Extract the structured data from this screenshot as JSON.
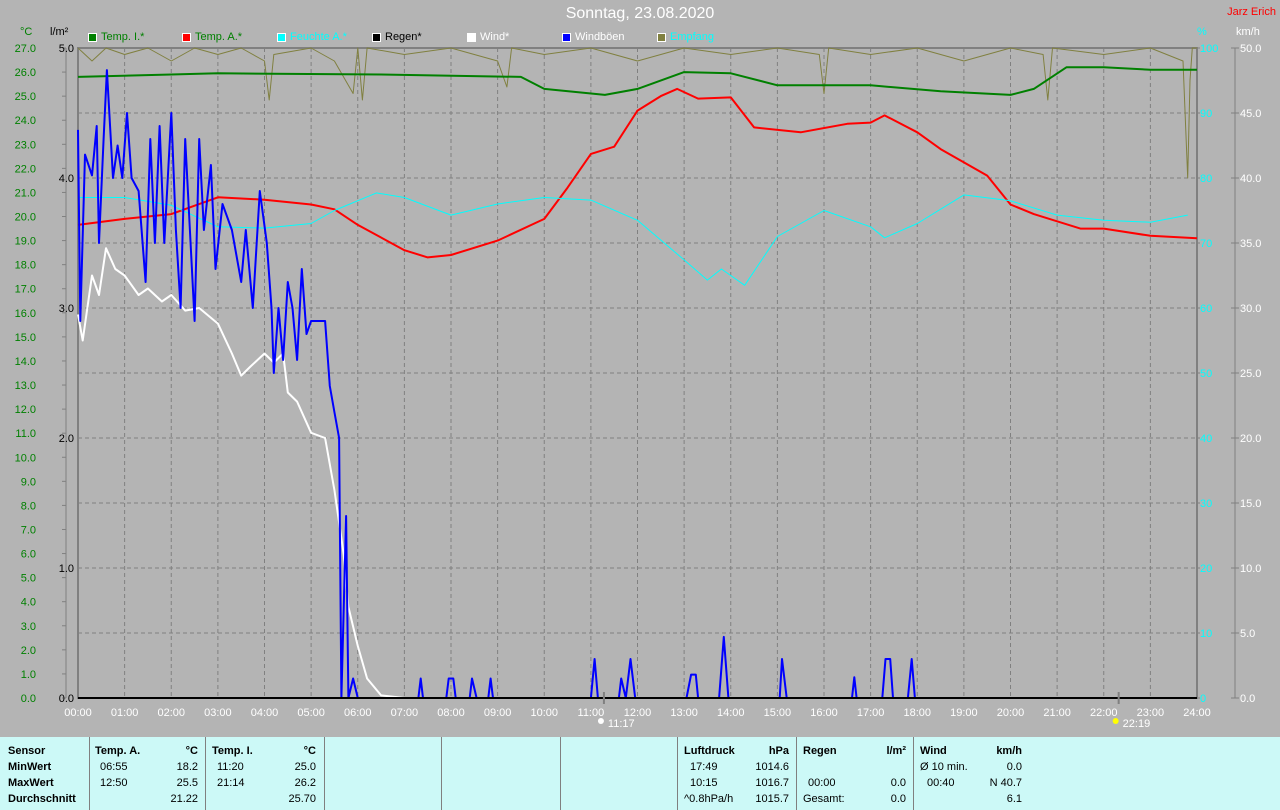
{
  "header": {
    "title": "Sonntag, 23.08.2020",
    "author": "Jarz Erich",
    "unit_temp": "°C",
    "unit_rain": "l/m²",
    "unit_hum": "%",
    "unit_wind": "km/h"
  },
  "legend": [
    {
      "label": "Temp. I.*",
      "color": "#008000",
      "text_color": "#008000"
    },
    {
      "label": "Temp. A.*",
      "color": "#ff0000",
      "text_color": "#008000"
    },
    {
      "label": "Feuchte A.*",
      "color": "#00ffff",
      "text_color": "#00ffff"
    },
    {
      "label": "Regen*",
      "color": "#000000",
      "text_color": "#000000"
    },
    {
      "label": "Wind*",
      "color": "#ffffff",
      "text_color": "#ffffff"
    },
    {
      "label": "Windböen",
      "color": "#0000ff",
      "text_color": "#ffffff"
    },
    {
      "label": "Empfang",
      "color": "#808040",
      "text_color": "#00ffff"
    }
  ],
  "chart_data": {
    "type": "line",
    "title": "Sonntag, 23.08.2020",
    "xlim": [
      0,
      24
    ],
    "x_ticks": [
      "00:00",
      "01:00",
      "02:00",
      "03:00",
      "04:00",
      "05:00",
      "06:00",
      "07:00",
      "08:00",
      "09:00",
      "10:00",
      "11:00",
      "12:00",
      "13:00",
      "14:00",
      "15:00",
      "16:00",
      "17:00",
      "18:00",
      "19:00",
      "20:00",
      "21:00",
      "22:00",
      "23:00",
      "24:00"
    ],
    "axes": {
      "temp": {
        "label": "°C",
        "ylim": [
          0,
          27
        ],
        "ticks": [
          "0.0",
          "1.0",
          "2.0",
          "3.0",
          "4.0",
          "5.0",
          "6.0",
          "7.0",
          "8.0",
          "9.0",
          "10.0",
          "11.0",
          "12.0",
          "13.0",
          "14.0",
          "15.0",
          "16.0",
          "17.0",
          "18.0",
          "19.0",
          "20.0",
          "21.0",
          "22.0",
          "23.0",
          "24.0",
          "25.0",
          "26.0",
          "27.0"
        ]
      },
      "rain": {
        "label": "l/m²",
        "ylim": [
          0,
          5
        ],
        "ticks": [
          "0.0",
          "1.0",
          "2.0",
          "3.0",
          "4.0",
          "5.0"
        ]
      },
      "hum": {
        "label": "%",
        "ylim": [
          0,
          100
        ],
        "ticks": [
          "0",
          "10",
          "20",
          "30",
          "40",
          "50",
          "60",
          "70",
          "80",
          "90",
          "100"
        ]
      },
      "wind": {
        "label": "km/h",
        "ylim": [
          0,
          50
        ],
        "ticks": [
          "0.0",
          "5.0",
          "10.0",
          "15.0",
          "20.0",
          "25.0",
          "30.0",
          "35.0",
          "40.0",
          "45.0",
          "50.0"
        ]
      }
    },
    "series": [
      {
        "name": "Empfang",
        "axis": "hum",
        "color": "#808040",
        "points": [
          [
            0,
            100
          ],
          [
            0.3,
            98
          ],
          [
            0.6,
            100
          ],
          [
            1,
            99
          ],
          [
            1.5,
            100
          ],
          [
            2,
            98
          ],
          [
            2.5,
            100
          ],
          [
            3,
            99
          ],
          [
            3.5,
            100
          ],
          [
            4,
            98
          ],
          [
            4.1,
            92
          ],
          [
            4.2,
            99
          ],
          [
            5,
            100
          ],
          [
            5.5,
            98
          ],
          [
            5.9,
            93
          ],
          [
            6,
            100
          ],
          [
            6.1,
            92
          ],
          [
            6.2,
            100
          ],
          [
            7,
            99
          ],
          [
            8,
            100
          ],
          [
            9,
            98
          ],
          [
            9.2,
            94
          ],
          [
            9.3,
            100
          ],
          [
            10,
            99
          ],
          [
            11,
            100
          ],
          [
            12,
            98
          ],
          [
            13,
            100
          ],
          [
            14,
            99
          ],
          [
            15,
            100
          ],
          [
            15.9,
            99
          ],
          [
            16,
            93
          ],
          [
            16.1,
            100
          ],
          [
            17,
            99
          ],
          [
            18,
            100
          ],
          [
            19,
            98
          ],
          [
            20,
            100
          ],
          [
            20.7,
            99
          ],
          [
            20.8,
            92
          ],
          [
            20.9,
            100
          ],
          [
            22,
            99
          ],
          [
            23,
            100
          ],
          [
            23.7,
            98
          ],
          [
            23.8,
            80
          ],
          [
            23.85,
            95
          ],
          [
            23.9,
            100
          ],
          [
            24,
            100
          ]
        ]
      },
      {
        "name": "Temp. I.",
        "axis": "temp",
        "color": "#008000",
        "points": [
          [
            0,
            25.8
          ],
          [
            2,
            25.9
          ],
          [
            3,
            25.95
          ],
          [
            6.5,
            25.9
          ],
          [
            9.5,
            25.8
          ],
          [
            10,
            25.3
          ],
          [
            11.3,
            25.05
          ],
          [
            12,
            25.3
          ],
          [
            13,
            26.0
          ],
          [
            14,
            25.95
          ],
          [
            15,
            25.45
          ],
          [
            17,
            25.45
          ],
          [
            18.5,
            25.2
          ],
          [
            20,
            25.05
          ],
          [
            20.5,
            25.3
          ],
          [
            21.2,
            26.2
          ],
          [
            22,
            26.2
          ],
          [
            23,
            26.1
          ],
          [
            24,
            26.1
          ]
        ]
      },
      {
        "name": "Temp. A.",
        "axis": "temp",
        "color": "#ff0000",
        "points": [
          [
            0,
            19.65
          ],
          [
            1,
            19.9
          ],
          [
            2,
            20.1
          ],
          [
            3,
            20.8
          ],
          [
            4,
            20.7
          ],
          [
            5,
            20.5
          ],
          [
            5.5,
            20.3
          ],
          [
            6,
            19.65
          ],
          [
            7,
            18.6
          ],
          [
            7.5,
            18.3
          ],
          [
            8,
            18.4
          ],
          [
            9,
            19.0
          ],
          [
            10,
            19.9
          ],
          [
            10.5,
            21.2
          ],
          [
            11,
            22.6
          ],
          [
            11.5,
            22.9
          ],
          [
            12,
            24.4
          ],
          [
            12.5,
            25.0
          ],
          [
            12.85,
            25.3
          ],
          [
            13.3,
            24.9
          ],
          [
            14,
            24.95
          ],
          [
            14.5,
            23.7
          ],
          [
            15.5,
            23.5
          ],
          [
            16.5,
            23.85
          ],
          [
            17,
            23.9
          ],
          [
            17.3,
            24.2
          ],
          [
            18,
            23.5
          ],
          [
            18.5,
            22.8
          ],
          [
            19.5,
            21.7
          ],
          [
            20,
            20.5
          ],
          [
            20.5,
            20.1
          ],
          [
            21.5,
            19.5
          ],
          [
            22,
            19.5
          ],
          [
            23,
            19.2
          ],
          [
            24,
            19.1
          ]
        ]
      },
      {
        "name": "Feuchte A.",
        "axis": "hum",
        "color": "#00ffff",
        "points": [
          [
            0,
            77
          ],
          [
            1,
            77
          ],
          [
            2,
            75.8
          ],
          [
            3,
            72.5
          ],
          [
            4,
            72.3
          ],
          [
            5,
            73
          ],
          [
            5.5,
            75
          ],
          [
            6.4,
            77.7
          ],
          [
            7,
            77
          ],
          [
            8,
            74.3
          ],
          [
            9,
            76
          ],
          [
            10,
            77
          ],
          [
            11,
            76.6
          ],
          [
            12,
            73.5
          ],
          [
            13,
            67.4
          ],
          [
            13.5,
            64.3
          ],
          [
            13.8,
            66
          ],
          [
            14.3,
            63.5
          ],
          [
            15,
            71
          ],
          [
            16,
            75
          ],
          [
            17,
            72.5
          ],
          [
            17.3,
            70.8
          ],
          [
            18,
            73
          ],
          [
            19,
            77.4
          ],
          [
            20,
            76.5
          ],
          [
            21,
            74.3
          ],
          [
            22,
            73.5
          ],
          [
            23,
            73.2
          ],
          [
            23.8,
            74.3
          ]
        ]
      },
      {
        "name": "Wind",
        "axis": "wind",
        "color": "#ffffff",
        "points": [
          [
            0,
            29.5
          ],
          [
            0.1,
            27.5
          ],
          [
            0.3,
            32.5
          ],
          [
            0.45,
            31
          ],
          [
            0.6,
            34.6
          ],
          [
            0.8,
            33
          ],
          [
            1,
            32.5
          ],
          [
            1.3,
            31
          ],
          [
            1.5,
            31.5
          ],
          [
            1.8,
            30.5
          ],
          [
            2,
            31
          ],
          [
            2.3,
            29.8
          ],
          [
            2.6,
            30
          ],
          [
            3,
            28.8
          ],
          [
            3.3,
            26.5
          ],
          [
            3.5,
            24.8
          ],
          [
            3.7,
            25.5
          ],
          [
            4,
            26.5
          ],
          [
            4.2,
            25.8
          ],
          [
            4.4,
            26.5
          ],
          [
            4.5,
            23.5
          ],
          [
            4.7,
            22.8
          ],
          [
            5,
            20.4
          ],
          [
            5.3,
            20
          ],
          [
            5.5,
            16
          ],
          [
            5.7,
            11
          ],
          [
            5.8,
            7
          ],
          [
            6,
            4
          ],
          [
            6.2,
            1.5
          ],
          [
            6.5,
            0.2
          ],
          [
            7,
            0
          ],
          [
            24,
            0
          ]
        ]
      },
      {
        "name": "Windböen",
        "axis": "wind",
        "color": "#0000ff",
        "points": [
          [
            0,
            43.7
          ],
          [
            0.05,
            29
          ],
          [
            0.15,
            41.8
          ],
          [
            0.3,
            40.2
          ],
          [
            0.4,
            44
          ],
          [
            0.45,
            35
          ],
          [
            0.55,
            43
          ],
          [
            0.62,
            48.3
          ],
          [
            0.75,
            40
          ],
          [
            0.85,
            42.5
          ],
          [
            0.95,
            40
          ],
          [
            1.05,
            45
          ],
          [
            1.15,
            40
          ],
          [
            1.3,
            39
          ],
          [
            1.45,
            32
          ],
          [
            1.55,
            43
          ],
          [
            1.65,
            35
          ],
          [
            1.75,
            44
          ],
          [
            1.85,
            35
          ],
          [
            2.0,
            45
          ],
          [
            2.1,
            36
          ],
          [
            2.2,
            30
          ],
          [
            2.3,
            43
          ],
          [
            2.4,
            36
          ],
          [
            2.5,
            29
          ],
          [
            2.6,
            43
          ],
          [
            2.7,
            36
          ],
          [
            2.85,
            41
          ],
          [
            2.95,
            33
          ],
          [
            3.1,
            38
          ],
          [
            3.3,
            36
          ],
          [
            3.5,
            32
          ],
          [
            3.6,
            36
          ],
          [
            3.75,
            30
          ],
          [
            3.9,
            39
          ],
          [
            4.05,
            35
          ],
          [
            4.15,
            30
          ],
          [
            4.2,
            25
          ],
          [
            4.3,
            30
          ],
          [
            4.4,
            26
          ],
          [
            4.5,
            32
          ],
          [
            4.6,
            30
          ],
          [
            4.7,
            26
          ],
          [
            4.8,
            33
          ],
          [
            4.9,
            28
          ],
          [
            5.0,
            29
          ],
          [
            5.3,
            29
          ],
          [
            5.4,
            24
          ],
          [
            5.5,
            22
          ],
          [
            5.6,
            20
          ],
          [
            5.65,
            0
          ],
          [
            5.75,
            14
          ],
          [
            5.8,
            0
          ],
          [
            5.9,
            1.5
          ],
          [
            6.0,
            0
          ],
          [
            7.3,
            0
          ],
          [
            7.35,
            1.5
          ],
          [
            7.4,
            0
          ],
          [
            7.9,
            0
          ],
          [
            7.95,
            1.5
          ],
          [
            8.05,
            1.5
          ],
          [
            8.1,
            0
          ],
          [
            8.4,
            0
          ],
          [
            8.45,
            1.5
          ],
          [
            8.55,
            0
          ],
          [
            8.8,
            0
          ],
          [
            8.85,
            1.5
          ],
          [
            8.9,
            0
          ],
          [
            11.0,
            0
          ],
          [
            11.08,
            3
          ],
          [
            11.15,
            0
          ],
          [
            11.6,
            0
          ],
          [
            11.65,
            1.5
          ],
          [
            11.75,
            0
          ],
          [
            11.85,
            3
          ],
          [
            11.95,
            0
          ],
          [
            13.05,
            0
          ],
          [
            13.15,
            1.8
          ],
          [
            13.25,
            1.8
          ],
          [
            13.3,
            0
          ],
          [
            13.75,
            0
          ],
          [
            13.85,
            4.7
          ],
          [
            13.95,
            0
          ],
          [
            15.05,
            0
          ],
          [
            15.1,
            3
          ],
          [
            15.2,
            0
          ],
          [
            16.6,
            0
          ],
          [
            16.65,
            1.6
          ],
          [
            16.7,
            0
          ],
          [
            17.25,
            0
          ],
          [
            17.32,
            3
          ],
          [
            17.42,
            3
          ],
          [
            17.48,
            0
          ],
          [
            17.8,
            0
          ],
          [
            17.88,
            3
          ],
          [
            17.95,
            0
          ],
          [
            24,
            0
          ]
        ]
      },
      {
        "name": "Regen",
        "axis": "rain",
        "color": "#000000",
        "points": [
          [
            0,
            0
          ],
          [
            24,
            0
          ]
        ]
      }
    ],
    "sun": {
      "sunrise": "11:17",
      "sunset": "22:19",
      "sunrise_h": 11.28,
      "sunset_h": 22.32
    }
  },
  "stats": {
    "sensor_label": "Sensor",
    "min_label": "MinWert",
    "max_label": "MaxWert",
    "avg_label": "Durchschnitt",
    "temp_a": {
      "title": "Temp. A.",
      "unit": "°C",
      "min_time": "06:55",
      "min": "18.2",
      "max_time": "12:50",
      "max": "25.5",
      "avg": "21.22"
    },
    "temp_i": {
      "title": "Temp. I.",
      "unit": "°C",
      "min_time": "11:20",
      "min": "25.0",
      "max_time": "21:14",
      "max": "26.2",
      "avg": "25.70"
    },
    "pressure": {
      "title": "Luftdruck",
      "unit": "hPa",
      "r1_label": "17:49",
      "r1": "1014.6",
      "r2_label": "10:15",
      "r2": "1016.7",
      "r3_label": "^0.8hPa/h",
      "r3": "1015.7"
    },
    "rain": {
      "title": "Regen",
      "unit": "l/m²",
      "r2_label": "00:00",
      "r2": "0.0",
      "r3_label": "Gesamt:",
      "r3": "0.0"
    },
    "wind": {
      "title": "Wind",
      "unit": "km/h",
      "r1_label": "Ø 10 min.",
      "r1": "0.0",
      "r2_label": "00:40",
      "r2": "N 40.7",
      "r3": "6.1"
    }
  }
}
